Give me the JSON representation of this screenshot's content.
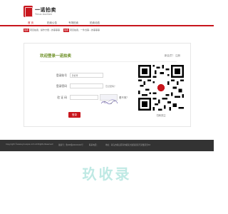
{
  "header": {
    "logo_text": "一诺拍卖",
    "logo_sub": "Yinuo Auction"
  },
  "nav": {
    "items": [
      {
        "label": "首 页",
        "active": true
      },
      {
        "label": "拍卖公告",
        "active": false
      },
      {
        "label": "专场拍卖",
        "active": false
      },
      {
        "label": "拍卖动态",
        "active": false
      }
    ]
  },
  "ticker": {
    "items": [
      {
        "tag": "拍卖",
        "text": "项目拍卖，操作方便…的事事事"
      },
      {
        "tag": "拍卖",
        "text": "项目拍卖，一件当事…的事事事"
      }
    ]
  },
  "login": {
    "title": "欢迎登录一诺拍卖",
    "side_link": "新会员？ 注册",
    "username_label": "登录账号",
    "username_placeholder": "手机号",
    "password_label": "登录密码",
    "forgot": "忘记密码？",
    "captcha_label": "验 证 码",
    "refresh": "看不清？",
    "submit_label": "登录"
  },
  "qr": {
    "caption": "扫码关注"
  },
  "footer": {
    "copyright": "Copyright ©www.yinuopai.com All Rights Reserved",
    "icp": "备案号：鲁ICP备XXXXXXX号",
    "contact": "联系电话：",
    "address": "地址：青岛市崂山区海尔路某大厦某座某号某楼某室XX"
  },
  "watermark": {
    "text": "玖收录"
  },
  "colors": {
    "brand_red": "#c8161d",
    "title_green": "#6b8e23",
    "footer_bg": "#333333",
    "watermark": "#bfe9e4"
  }
}
